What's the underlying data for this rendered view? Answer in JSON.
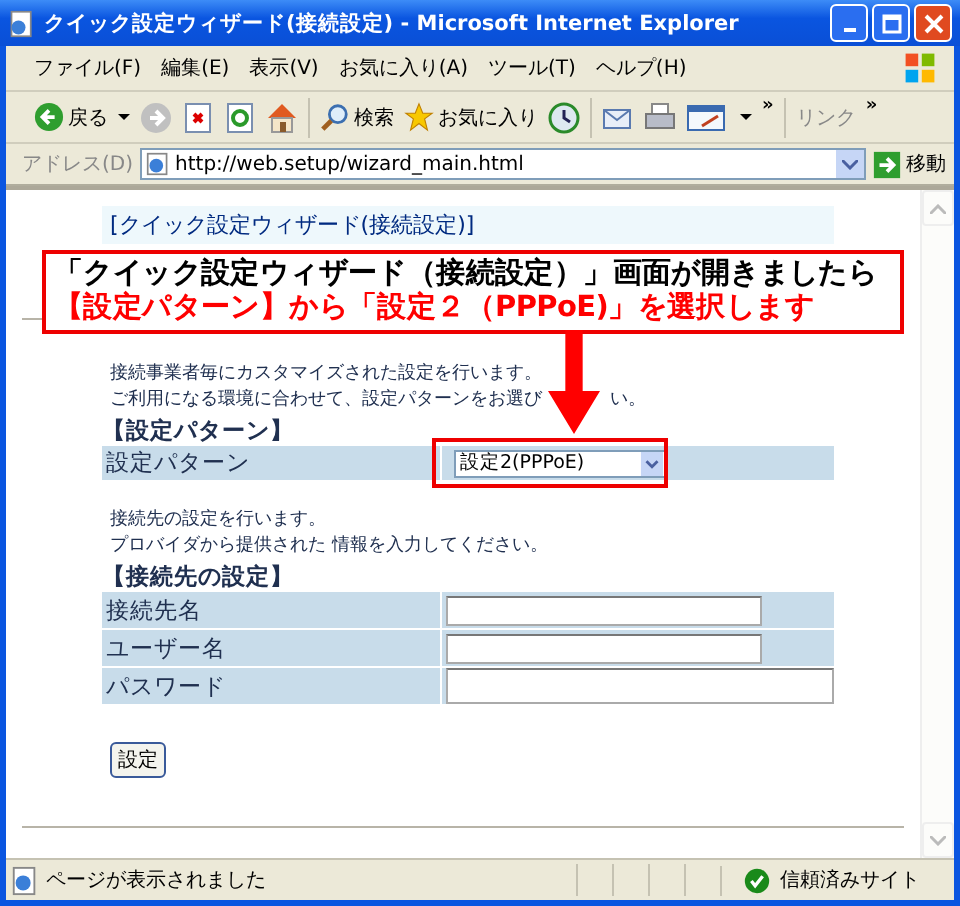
{
  "window": {
    "title": "クイック設定ウィザード(接続設定) - Microsoft Internet Explorer"
  },
  "menu": [
    "ファイル(F)",
    "編集(E)",
    "表示(V)",
    "お気に入り(A)",
    "ツール(T)",
    "ヘルプ(H)"
  ],
  "toolbar": {
    "back": "戻る",
    "search": "検索",
    "favorites": "お気に入り",
    "chevron": "»",
    "links": "リンク",
    "links_chevron": "»"
  },
  "address": {
    "label": "アドレス(D)",
    "url": "http://web.setup/wizard_main.html",
    "go": "移動"
  },
  "page": {
    "heading": "[クイック設定ウィザード(接続設定)]",
    "callout": [
      {
        "text": "「クイック設定ウィザード（接続設定）」画面が開きましたら",
        "color": "#000000"
      },
      {
        "text": "【設定パターン】から「設定２（PPPoE)」を選択します",
        "color": "#ff0000"
      }
    ],
    "pattern": {
      "intro": [
        [
          "接続事業者毎にカスタマイズされた設定を行います。"
        ],
        [
          "ご利用になる環境に合わせて、設定パターンをお選び",
          "い。"
        ]
      ],
      "heading": "【設定パターン】",
      "label": "設定パターン",
      "value": "設定2(PPPoE)"
    },
    "connection": {
      "intro": [
        "接続先の設定を行います。",
        "プロバイダから提供された 情報を入力してください。"
      ],
      "heading": "【接続先の設定】",
      "fields": [
        {
          "label": "接続先名"
        },
        {
          "label": "ユーザー名"
        },
        {
          "label": "パスワード"
        }
      ]
    },
    "submit": "設定"
  },
  "status": {
    "text": "ページが表示されました",
    "zone": "信頼済みサイト"
  }
}
